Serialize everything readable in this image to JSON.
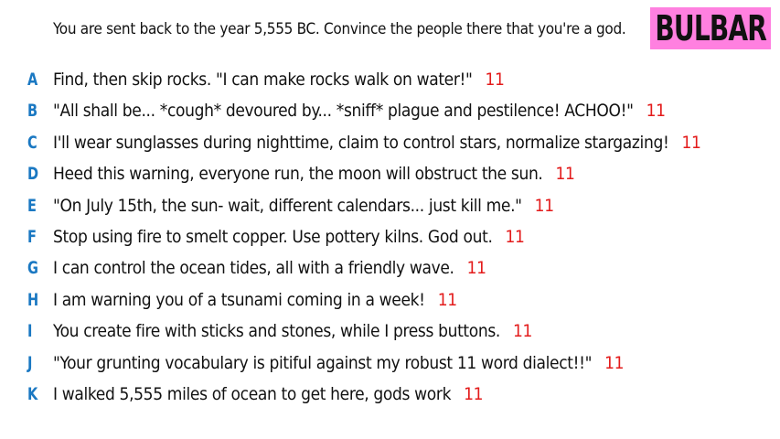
{
  "prompt": "You are sent back to the year 5,555 BC. Convince the people there that you're a god.",
  "badge": "BULBAR",
  "colors": {
    "badge_bg": "#ff80e0",
    "letter": "#1a78c2",
    "count": "#e31b1b"
  },
  "answers": [
    {
      "letter": "A",
      "text": "Find, then skip rocks. \"I can make rocks walk on water!\"",
      "count": "11"
    },
    {
      "letter": "B",
      "text": "\"All shall be... *cough* devoured by... *sniff* plague and pestilence! ACHOO!\"",
      "count": "11"
    },
    {
      "letter": "C",
      "text": "I'll wear sunglasses during nighttime, claim to control stars, normalize stargazing!",
      "count": "11"
    },
    {
      "letter": "D",
      "text": "Heed this warning, everyone run, the moon will obstruct the sun.",
      "count": "11"
    },
    {
      "letter": "E",
      "text": "\"On July 15th, the sun- wait, different calendars... just kill me.\"",
      "count": "11"
    },
    {
      "letter": "F",
      "text": "Stop using fire to smelt copper. Use pottery kilns. God out.",
      "count": "11"
    },
    {
      "letter": "G",
      "text": "I can control the ocean tides, all with a friendly wave.",
      "count": "11"
    },
    {
      "letter": "H",
      "text": "I am warning you of a tsunami coming in a week!",
      "count": "11"
    },
    {
      "letter": "I",
      "text": "You create fire with sticks and stones, while I press buttons.",
      "count": "11"
    },
    {
      "letter": "J",
      "text": "\"Your grunting vocabulary is pitiful against my robust 11 word dialect!!\"",
      "count": "11"
    },
    {
      "letter": "K",
      "text": "I walked 5,555 miles of ocean to get here, gods work",
      "count": "11"
    }
  ]
}
